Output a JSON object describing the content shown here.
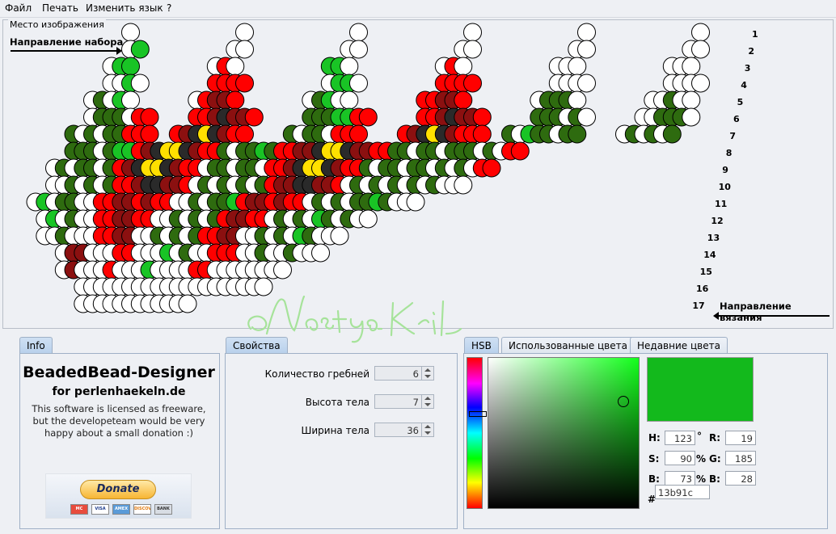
{
  "menu": {
    "file": "Файл",
    "print": "Печать",
    "language": "Изменить язык",
    "help": "?"
  },
  "canvas": {
    "title": "Место изображения",
    "direction_set": "Направление набора",
    "direction_knit": "Направление вязания",
    "row_numbers": [
      "1",
      "2",
      "3",
      "4",
      "5",
      "6",
      "7",
      "8",
      "9",
      "10",
      "11",
      "12",
      "13",
      "14",
      "15",
      "16",
      "17"
    ]
  },
  "pattern_colors": {
    "W": "#ffffff",
    "L": "#19c425",
    "G": "#2e6b0f",
    "R": "#ff0000",
    "M": "#8b1010",
    "K": "#2a2a2a",
    "Y": "#ffe000"
  },
  "tabs": {
    "info": "Info",
    "properties": "Свойства",
    "hsb": "HSB",
    "used_colors": "Использованные цвета",
    "recent_colors": "Недавние цвета"
  },
  "info": {
    "title": "BeadedBead-Designer",
    "subtitle": "for perlenhaekeln.de",
    "license": "This software is licensed as freeware, but the developeteam would be very happy about a small donation :)",
    "donate": "Donate",
    "cards": [
      "MC",
      "VISA",
      "AMEX",
      "DISCOVER",
      "BANK"
    ]
  },
  "properties": {
    "ribs_label": "Количество гребней",
    "ribs_value": "6",
    "height_label": "Высота тела",
    "height_value": "7",
    "width_label": "Ширина тела",
    "width_value": "36"
  },
  "hsb": {
    "h": "123",
    "s": "90",
    "b": "73",
    "r": "19",
    "g": "185",
    "b_rgb": "28",
    "hex": "13b91c",
    "h_label": "H:",
    "s_label": "S:",
    "b_label": "B:",
    "r_label": "R:",
    "g_label": "G:",
    "b2_label": "B:",
    "deg": "°",
    "pct": "%",
    "hash": "#",
    "selected_color": "#13b91c"
  }
}
